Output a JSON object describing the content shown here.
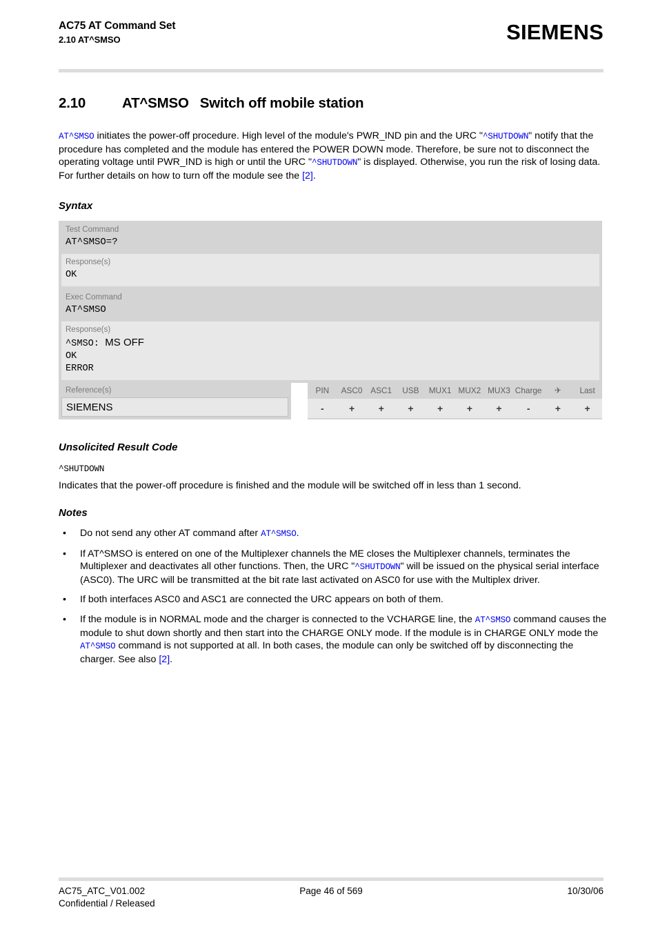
{
  "header": {
    "title": "AC75 AT Command Set",
    "subtitle": "2.10 AT^SMSO",
    "brand": "SIEMENS"
  },
  "section": {
    "number": "2.10",
    "command": "AT^SMSO",
    "title": "Switch off mobile station"
  },
  "intro": {
    "cmd_link": "AT^SMSO",
    "text_1": " initiates the power-off procedure. High level of the module's PWR_IND pin and the URC \"",
    "urc_link_1": "^SHUTDOWN",
    "text_2": "\" notify that the procedure has completed and the module has entered the POWER DOWN mode. Therefore, be sure not to disconnect the operating voltage until PWR_IND is high or until the URC \"",
    "urc_link_2": "^SHUTDOWN",
    "text_3": "\" is displayed. Otherwise, you run the risk of losing data. For further details on how to turn off the module see the ",
    "ref_link": "[2]",
    "text_4": "."
  },
  "headings": {
    "syntax": "Syntax",
    "urc": "Unsolicited Result Code",
    "notes": "Notes"
  },
  "syntax": {
    "test": {
      "label": "Test Command",
      "command": "AT^SMSO=?",
      "response_label": "Response(s)",
      "responses": [
        "OK"
      ]
    },
    "exec": {
      "label": "Exec Command",
      "command": "AT^SMSO",
      "response_label": "Response(s)",
      "response_prefix": "^SMSO:",
      "response_value": "MS OFF",
      "responses": [
        "OK",
        "ERROR"
      ]
    },
    "reference": {
      "label": "Reference(s)",
      "value": "SIEMENS"
    },
    "capabilities": {
      "columns": [
        "PIN",
        "ASC0",
        "ASC1",
        "USB",
        "MUX1",
        "MUX2",
        "MUX3",
        "Charge",
        "airplane-icon",
        "Last"
      ],
      "airplane_glyph": "✈",
      "values": [
        "-",
        "+",
        "+",
        "+",
        "+",
        "+",
        "+",
        "-",
        "+",
        "+"
      ]
    }
  },
  "urc": {
    "code": "^SHUTDOWN",
    "description": "Indicates that the power-off procedure is finished and the module will be switched off in less than 1 second."
  },
  "notes": {
    "bullet_glyph": "•",
    "items": [
      {
        "parts": [
          {
            "type": "text",
            "value": "Do not send any other AT command after "
          },
          {
            "type": "code-link",
            "value": "AT^SMSO"
          },
          {
            "type": "text",
            "value": "."
          }
        ]
      },
      {
        "parts": [
          {
            "type": "text",
            "value": "If AT^SMSO is entered on one of the Multiplexer channels the ME closes the Multiplexer channels, terminates the Multiplexer and deactivates all other functions. Then, the URC \""
          },
          {
            "type": "code-link",
            "value": "^SHUTDOWN"
          },
          {
            "type": "text",
            "value": "\" will be issued on the physical serial interface (ASC0). The URC will be transmitted at the bit rate last activated on ASC0 for use with the Multiplex driver."
          }
        ]
      },
      {
        "parts": [
          {
            "type": "text",
            "value": "If both interfaces ASC0 and ASC1 are connected the URC appears on both of them."
          }
        ]
      },
      {
        "parts": [
          {
            "type": "text",
            "value": "If the module is in NORMAL mode and the charger is connected to the VCHARGE line, the "
          },
          {
            "type": "code-link",
            "value": "AT^SMSO"
          },
          {
            "type": "text",
            "value": " command causes the module to shut down shortly and then start into the CHARGE ONLY mode. If the module is in CHARGE ONLY mode the "
          },
          {
            "type": "code-link",
            "value": "AT^SMSO"
          },
          {
            "type": "text",
            "value": " command is not supported at all. In both cases, the module can only be switched off by disconnecting the charger. See also "
          },
          {
            "type": "link",
            "value": "[2]"
          },
          {
            "type": "text",
            "value": "."
          }
        ]
      }
    ]
  },
  "footer": {
    "doc_id": "AC75_ATC_V01.002",
    "classification": "Confidential / Released",
    "page": "Page 46 of 569",
    "date": "10/30/06"
  },
  "colors": {
    "link": "#0000ee",
    "block_dark": "#d4d4d4",
    "block_light": "#e8e8e8",
    "rule": "#dcdcdc",
    "muted_label": "#7a7a7a"
  }
}
